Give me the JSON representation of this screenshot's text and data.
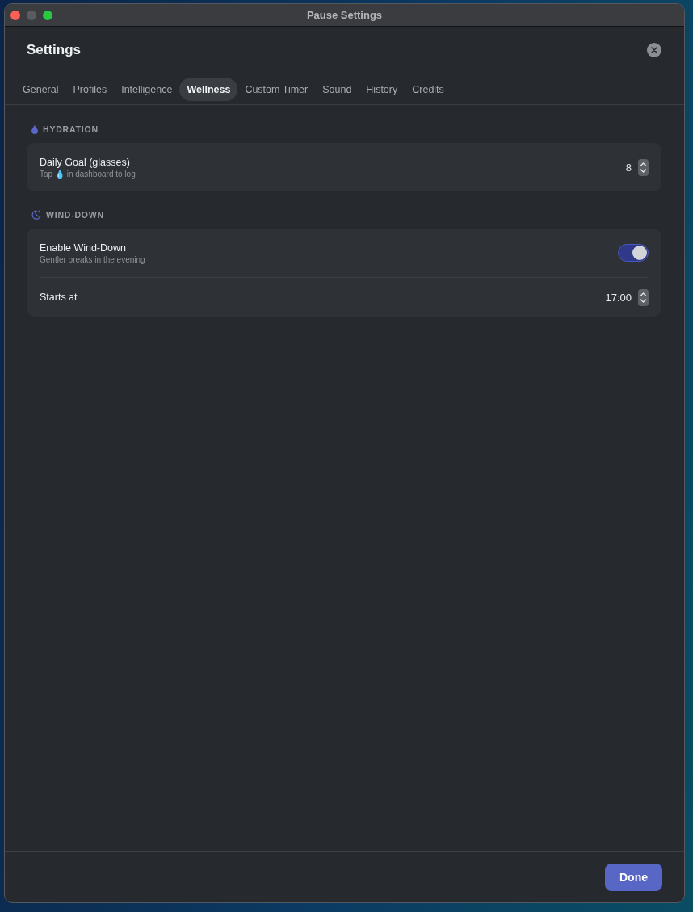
{
  "window": {
    "title": "Pause Settings",
    "controls": [
      {
        "kind": "close",
        "disabled": false
      },
      {
        "kind": "minimize",
        "disabled": true
      },
      {
        "kind": "zoom",
        "disabled": false
      }
    ]
  },
  "header": {
    "title": "Settings"
  },
  "tabs": [
    {
      "label": "General",
      "selected": false
    },
    {
      "label": "Profiles",
      "selected": false
    },
    {
      "label": "Intelligence",
      "selected": false
    },
    {
      "label": "Wellness",
      "selected": true
    },
    {
      "label": "Custom Timer",
      "selected": false
    },
    {
      "label": "Sound",
      "selected": false
    },
    {
      "label": "History",
      "selected": false
    },
    {
      "label": "Credits",
      "selected": false
    }
  ],
  "sections": [
    {
      "title": "HYDRATION",
      "rows": [
        {
          "kind": "stepper",
          "title": "Daily Goal (glasses)",
          "subtitle": "Tap 💧 in dashboard to log",
          "value": "8"
        }
      ]
    },
    {
      "title": "WIND-DOWN",
      "rows": [
        {
          "kind": "toggle",
          "title": "Enable Wind-Down",
          "subtitle": "Gentler breaks in the evening",
          "on": true
        },
        {
          "kind": "stepper",
          "title": "Starts at",
          "value": "17:00"
        }
      ]
    }
  ],
  "footer": {
    "button": "Done"
  }
}
